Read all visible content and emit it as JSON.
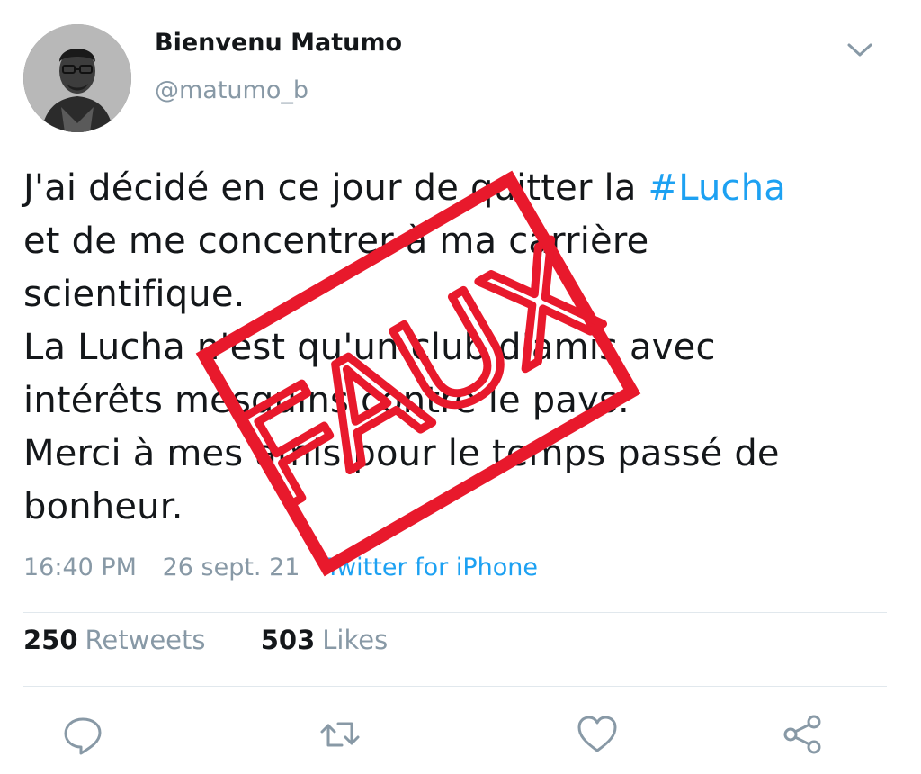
{
  "user": {
    "display_name": "Bienvenu Matumo",
    "handle": "@matumo_b"
  },
  "tweet": {
    "part1": "J'ai décidé en ce jour de quitter la ",
    "hashtag": "#Lucha",
    "part2": "\net de me concentrer à ma carrière\nscientifique.\nLa Lucha n'est qu'un club d'amis avec\nintérêts mesquins contre le pays.\nMerci à mes amis pour le temps passé de\nbonheur.",
    "time": "16:40 PM",
    "date": "26 sept. 21",
    "source": "Twitter for iPhone"
  },
  "stats": {
    "retweets_count": "250",
    "retweets_label": "Retweets",
    "likes_count": "503",
    "likes_label": "Likes"
  },
  "stamp": {
    "text": "FAUX",
    "color": "#e8192c"
  },
  "icons": {
    "menu": "chevron-down-icon",
    "reply": "reply-icon",
    "retweet": "retweet-icon",
    "like": "heart-icon",
    "share": "share-icon"
  },
  "colors": {
    "link": "#1da1f2",
    "secondary_text": "#8899a6",
    "primary_text": "#14171a"
  }
}
